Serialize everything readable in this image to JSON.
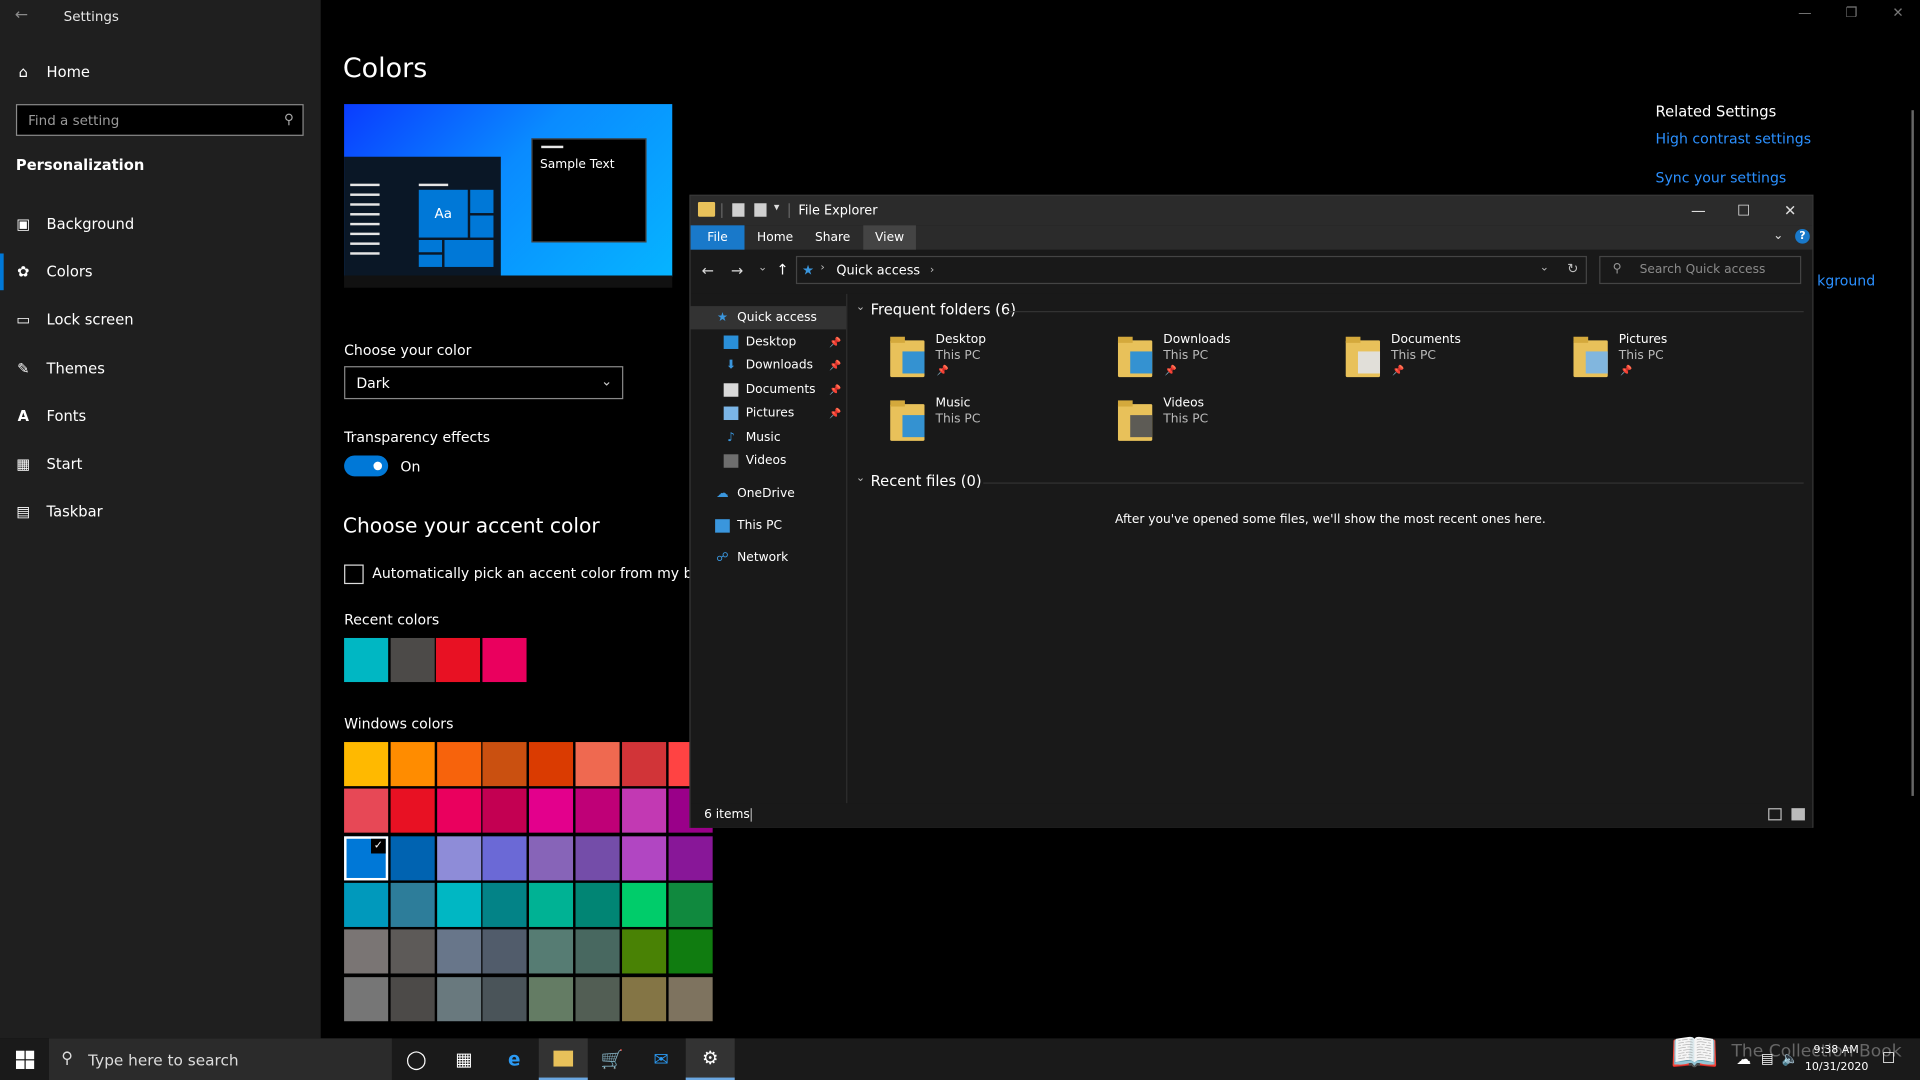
{
  "settings": {
    "window_title": "Settings",
    "search_placeholder": "Find a setting",
    "home_label": "Home",
    "section": "Personalization",
    "nav": [
      {
        "label": "Background",
        "icon": "image-icon"
      },
      {
        "label": "Colors",
        "icon": "palette-icon"
      },
      {
        "label": "Lock screen",
        "icon": "lock-screen-icon"
      },
      {
        "label": "Themes",
        "icon": "brush-icon"
      },
      {
        "label": "Fonts",
        "icon": "font-icon"
      },
      {
        "label": "Start",
        "icon": "start-icon"
      },
      {
        "label": "Taskbar",
        "icon": "taskbar-icon"
      }
    ],
    "active_nav": "Colors"
  },
  "colors_page": {
    "title": "Colors",
    "preview_sample_text": "Sample Text",
    "preview_aa": "Aa",
    "choose_color_label": "Choose your color",
    "choose_color_value": "Dark",
    "transparency_label": "Transparency effects",
    "transparency_state": "On",
    "accent_title": "Choose your accent color",
    "auto_pick_label": "Automatically pick an accent color from my background",
    "recent_colors_label": "Recent colors",
    "recent_colors": [
      "#00b7c3",
      "#4c4a48",
      "#e81123",
      "#ea005e"
    ],
    "windows_colors_label": "Windows colors",
    "windows_colors": [
      [
        "#ffb900",
        "#ff8c00",
        "#f7630c",
        "#ca5010",
        "#da3b01",
        "#ef6950",
        "#d13438",
        "#ff4343"
      ],
      [
        "#e74856",
        "#e81123",
        "#ea005e",
        "#c30052",
        "#e3008c",
        "#bf0077",
        "#c239b3",
        "#9a0089"
      ],
      [
        "#0078d7",
        "#0063b1",
        "#8e8cd8",
        "#6b69d6",
        "#8764b8",
        "#744da9",
        "#b146c2",
        "#881798"
      ],
      [
        "#0099bc",
        "#2d7d9a",
        "#00b7c3",
        "#038387",
        "#00b294",
        "#018574",
        "#00cc6a",
        "#10893e"
      ],
      [
        "#7a7574",
        "#5d5a58",
        "#68768a",
        "#515c6b",
        "#567c73",
        "#486860",
        "#498205",
        "#107c10"
      ],
      [
        "#767676",
        "#4c4a48",
        "#69797e",
        "#4a5459",
        "#647c64",
        "#525e54",
        "#847545",
        "#7e735f"
      ]
    ],
    "selected_color": "#0078d7"
  },
  "related": {
    "title": "Related Settings",
    "links": [
      "High contrast settings",
      "Sync your settings"
    ],
    "partial_link": "kground"
  },
  "explorer": {
    "title": "File Explorer",
    "tabs": [
      "File",
      "Home",
      "Share",
      "View"
    ],
    "active_tab": "View",
    "address": "Quick access",
    "search_placeholder": "Search Quick access",
    "nav": [
      {
        "label": "Quick access",
        "icon": "star-icon",
        "pinned": false
      },
      {
        "label": "Desktop",
        "icon": "desktop-icon",
        "pinned": true
      },
      {
        "label": "Downloads",
        "icon": "download-icon",
        "pinned": true
      },
      {
        "label": "Documents",
        "icon": "documents-icon",
        "pinned": true
      },
      {
        "label": "Pictures",
        "icon": "pictures-icon",
        "pinned": true
      },
      {
        "label": "Music",
        "icon": "music-icon",
        "pinned": false
      },
      {
        "label": "Videos",
        "icon": "videos-icon",
        "pinned": false
      },
      {
        "label": "OneDrive",
        "icon": "cloud-icon",
        "pinned": false
      },
      {
        "label": "This PC",
        "icon": "computer-icon",
        "pinned": false
      },
      {
        "label": "Network",
        "icon": "network-icon",
        "pinned": false
      }
    ],
    "frequent_header": "Frequent folders (6)",
    "folders": [
      {
        "name": "Desktop",
        "location": "This PC",
        "pinned": true,
        "badge": "desktop"
      },
      {
        "name": "Downloads",
        "location": "This PC",
        "pinned": true,
        "badge": "download"
      },
      {
        "name": "Documents",
        "location": "This PC",
        "pinned": true,
        "badge": "documents"
      },
      {
        "name": "Pictures",
        "location": "This PC",
        "pinned": true,
        "badge": "pictures"
      },
      {
        "name": "Music",
        "location": "This PC",
        "pinned": false,
        "badge": "music"
      },
      {
        "name": "Videos",
        "location": "This PC",
        "pinned": false,
        "badge": "videos"
      }
    ],
    "recent_header": "Recent files (0)",
    "recent_empty": "After you've opened some files, we'll show the most recent ones here.",
    "status": "6 items"
  },
  "taskbar": {
    "search_placeholder": "Type here to search",
    "time": "9:38 AM",
    "date": "10/31/2020",
    "watermark": "The Collection Book",
    "apps": [
      "cortana-icon",
      "task-view-icon",
      "edge-icon",
      "file-explorer-icon",
      "store-icon",
      "mail-icon",
      "settings-icon"
    ],
    "active_apps": [
      "file-explorer-icon",
      "settings-icon"
    ]
  }
}
